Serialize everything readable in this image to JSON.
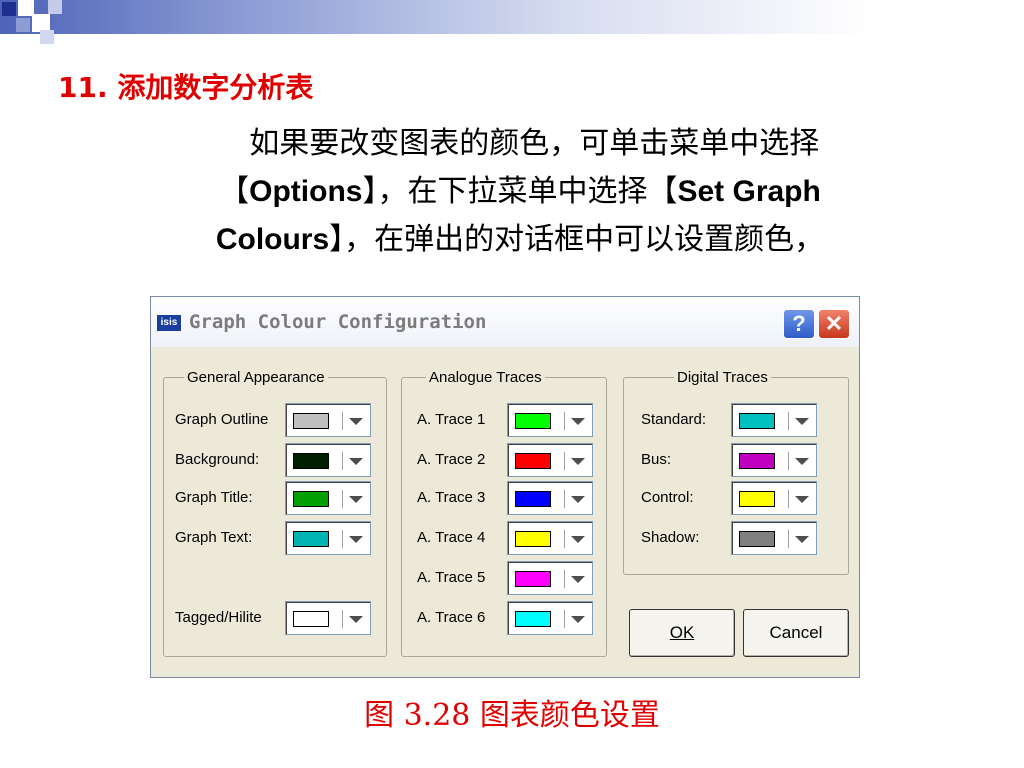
{
  "slide": {
    "title": "11. 添加数字分析表",
    "paragraph": {
      "line1": "如果要改变图表的颜色，可单击菜单中选择",
      "l2a": "【",
      "options": "Options",
      "l2b": "】，在下拉菜单中选择【",
      "setgraph": "Set Graph",
      "colours": "Colours",
      "l3b": "】，在弹出的对话框中可以设置颜色，"
    },
    "caption": "图 3.28 图表颜色设置"
  },
  "dialog": {
    "title": "Graph Colour Configuration",
    "icon_text": "isis",
    "help_label": "?",
    "close_label": "✕",
    "groups": {
      "general": {
        "legend": "General Appearance",
        "items": [
          {
            "label": "Graph Outline",
            "color": "#c0c0c0"
          },
          {
            "label": "Background:",
            "color": "#002000"
          },
          {
            "label": "Graph Title:",
            "color": "#00a000"
          },
          {
            "label": "Graph Text:",
            "color": "#00b4b4"
          },
          {
            "label": "Tagged/Hilite",
            "color": "#ffffff"
          }
        ]
      },
      "analogue": {
        "legend": "Analogue Traces",
        "items": [
          {
            "label": "A. Trace 1",
            "color": "#00ff00"
          },
          {
            "label": "A. Trace 2",
            "color": "#ff0000"
          },
          {
            "label": "A. Trace 3",
            "color": "#0000ff"
          },
          {
            "label": "A. Trace 4",
            "color": "#ffff00"
          },
          {
            "label": "A. Trace 5",
            "color": "#ff00ff"
          },
          {
            "label": "A. Trace 6",
            "color": "#00ffff"
          }
        ]
      },
      "digital": {
        "legend": "Digital Traces",
        "items": [
          {
            "label": "Standard:",
            "color": "#00c0c0"
          },
          {
            "label": "Bus:",
            "color": "#c000c0"
          },
          {
            "label": "Control:",
            "color": "#ffff00"
          },
          {
            "label": "Shadow:",
            "color": "#808080"
          }
        ]
      }
    },
    "ok_label": "OK",
    "cancel_label": "Cancel"
  }
}
